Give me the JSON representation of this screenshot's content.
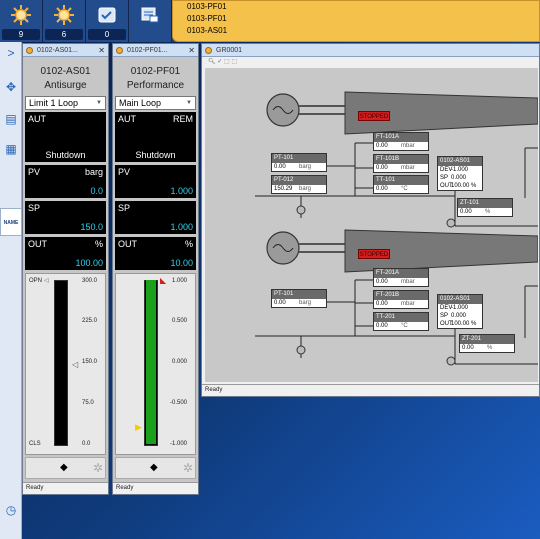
{
  "topbar": {
    "buttons": [
      {
        "icon": "alarm-burst-icon",
        "count": "9"
      },
      {
        "icon": "alarm-burst-icon",
        "count": "6"
      },
      {
        "icon": "acknowledge-icon",
        "count": "0"
      },
      {
        "icon": "alarm-list-icon",
        "count": ""
      }
    ],
    "alarms": [
      "0103-PF01",
      "0103-PF01",
      "0103-AS01"
    ]
  },
  "sidebar": {
    "tab_label": "NAME"
  },
  "faceplates": [
    {
      "window_title": "0102-AS01...",
      "tag": "0102-AS01",
      "desc": "Antisurge",
      "mode": "Limit 1 Loop",
      "ctrl_left": "AUT",
      "ctrl_right": "",
      "ctrl_state": "Shutdown",
      "pv_label": "PV",
      "pv_unit": "barg",
      "pv_value": "0.0",
      "sp_label": "SP",
      "sp_value": "150.0",
      "out_label": "OUT",
      "out_unit": "%",
      "out_value": "100.00",
      "gauge_ticks": [
        "300.0",
        "225.0",
        "150.0",
        "75.0",
        "0.0"
      ],
      "gauge_top_label": "OPN",
      "gauge_bottom_label": "CLS",
      "gauge_fill_fraction": 0.0,
      "status": "Ready"
    },
    {
      "window_title": "0102-PF01...",
      "tag": "0102-PF01",
      "desc": "Performance",
      "mode": "Main Loop",
      "ctrl_left": "AUT",
      "ctrl_right": "REM",
      "ctrl_state": "Shutdown",
      "pv_label": "PV",
      "pv_unit": "",
      "pv_value": "1.000",
      "sp_label": "SP",
      "sp_value": "1.000",
      "out_label": "OUT",
      "out_unit": "%",
      "out_value": "10.00",
      "gauge_ticks": [
        "1.000",
        "0.500",
        "0.000",
        "-0.500",
        "-1.000"
      ],
      "gauge_top_label": "",
      "gauge_bottom_label": "",
      "gauge_fill_fraction": 1.0,
      "status": "Ready"
    }
  ],
  "graphic": {
    "window_title": "GR0001",
    "status": "Ready",
    "unit1": {
      "stopped": "STOPPED",
      "ft_a": {
        "tag": "FT-101A",
        "value": "0.00",
        "unit": "mbar"
      },
      "ft_b": {
        "tag": "FT-101B",
        "value": "0.00",
        "unit": "mbar"
      },
      "tt": {
        "tag": "TT-101",
        "value": "0.00",
        "unit": "°C"
      },
      "pt_a": {
        "tag": "PT-101",
        "value": "0.00",
        "unit": "barg"
      },
      "pt_b": {
        "tag": "PT-012",
        "value": "150.29",
        "unit": "barg"
      },
      "ctl": {
        "tag": "0102-AS01",
        "dev": "-1.000",
        "sp": "0.000",
        "out": "100.00",
        "out_unit": "%"
      },
      "zt": {
        "tag": "ZT-101",
        "value": "0.00",
        "unit": "%"
      }
    },
    "unit2": {
      "stopped": "STOPPED",
      "ft_a": {
        "tag": "FT-201A",
        "value": "0.00",
        "unit": "mbar"
      },
      "ft_b": {
        "tag": "FT-201B",
        "value": "0.00",
        "unit": "mbar"
      },
      "tt": {
        "tag": "TT-201",
        "value": "0.00",
        "unit": "°C"
      },
      "pt_a": {
        "tag": "PT-101",
        "value": "0.00",
        "unit": "barg"
      },
      "ctl": {
        "tag": "0102-AS01",
        "dev": "-1.000",
        "sp": "0.000",
        "out": "100.00",
        "out_unit": "%"
      },
      "zt": {
        "tag": "ZT-201",
        "value": "0.00",
        "unit": "%"
      }
    },
    "ctl_labels": {
      "dev": "DEV",
      "sp": "SP",
      "out": "OUT"
    }
  }
}
